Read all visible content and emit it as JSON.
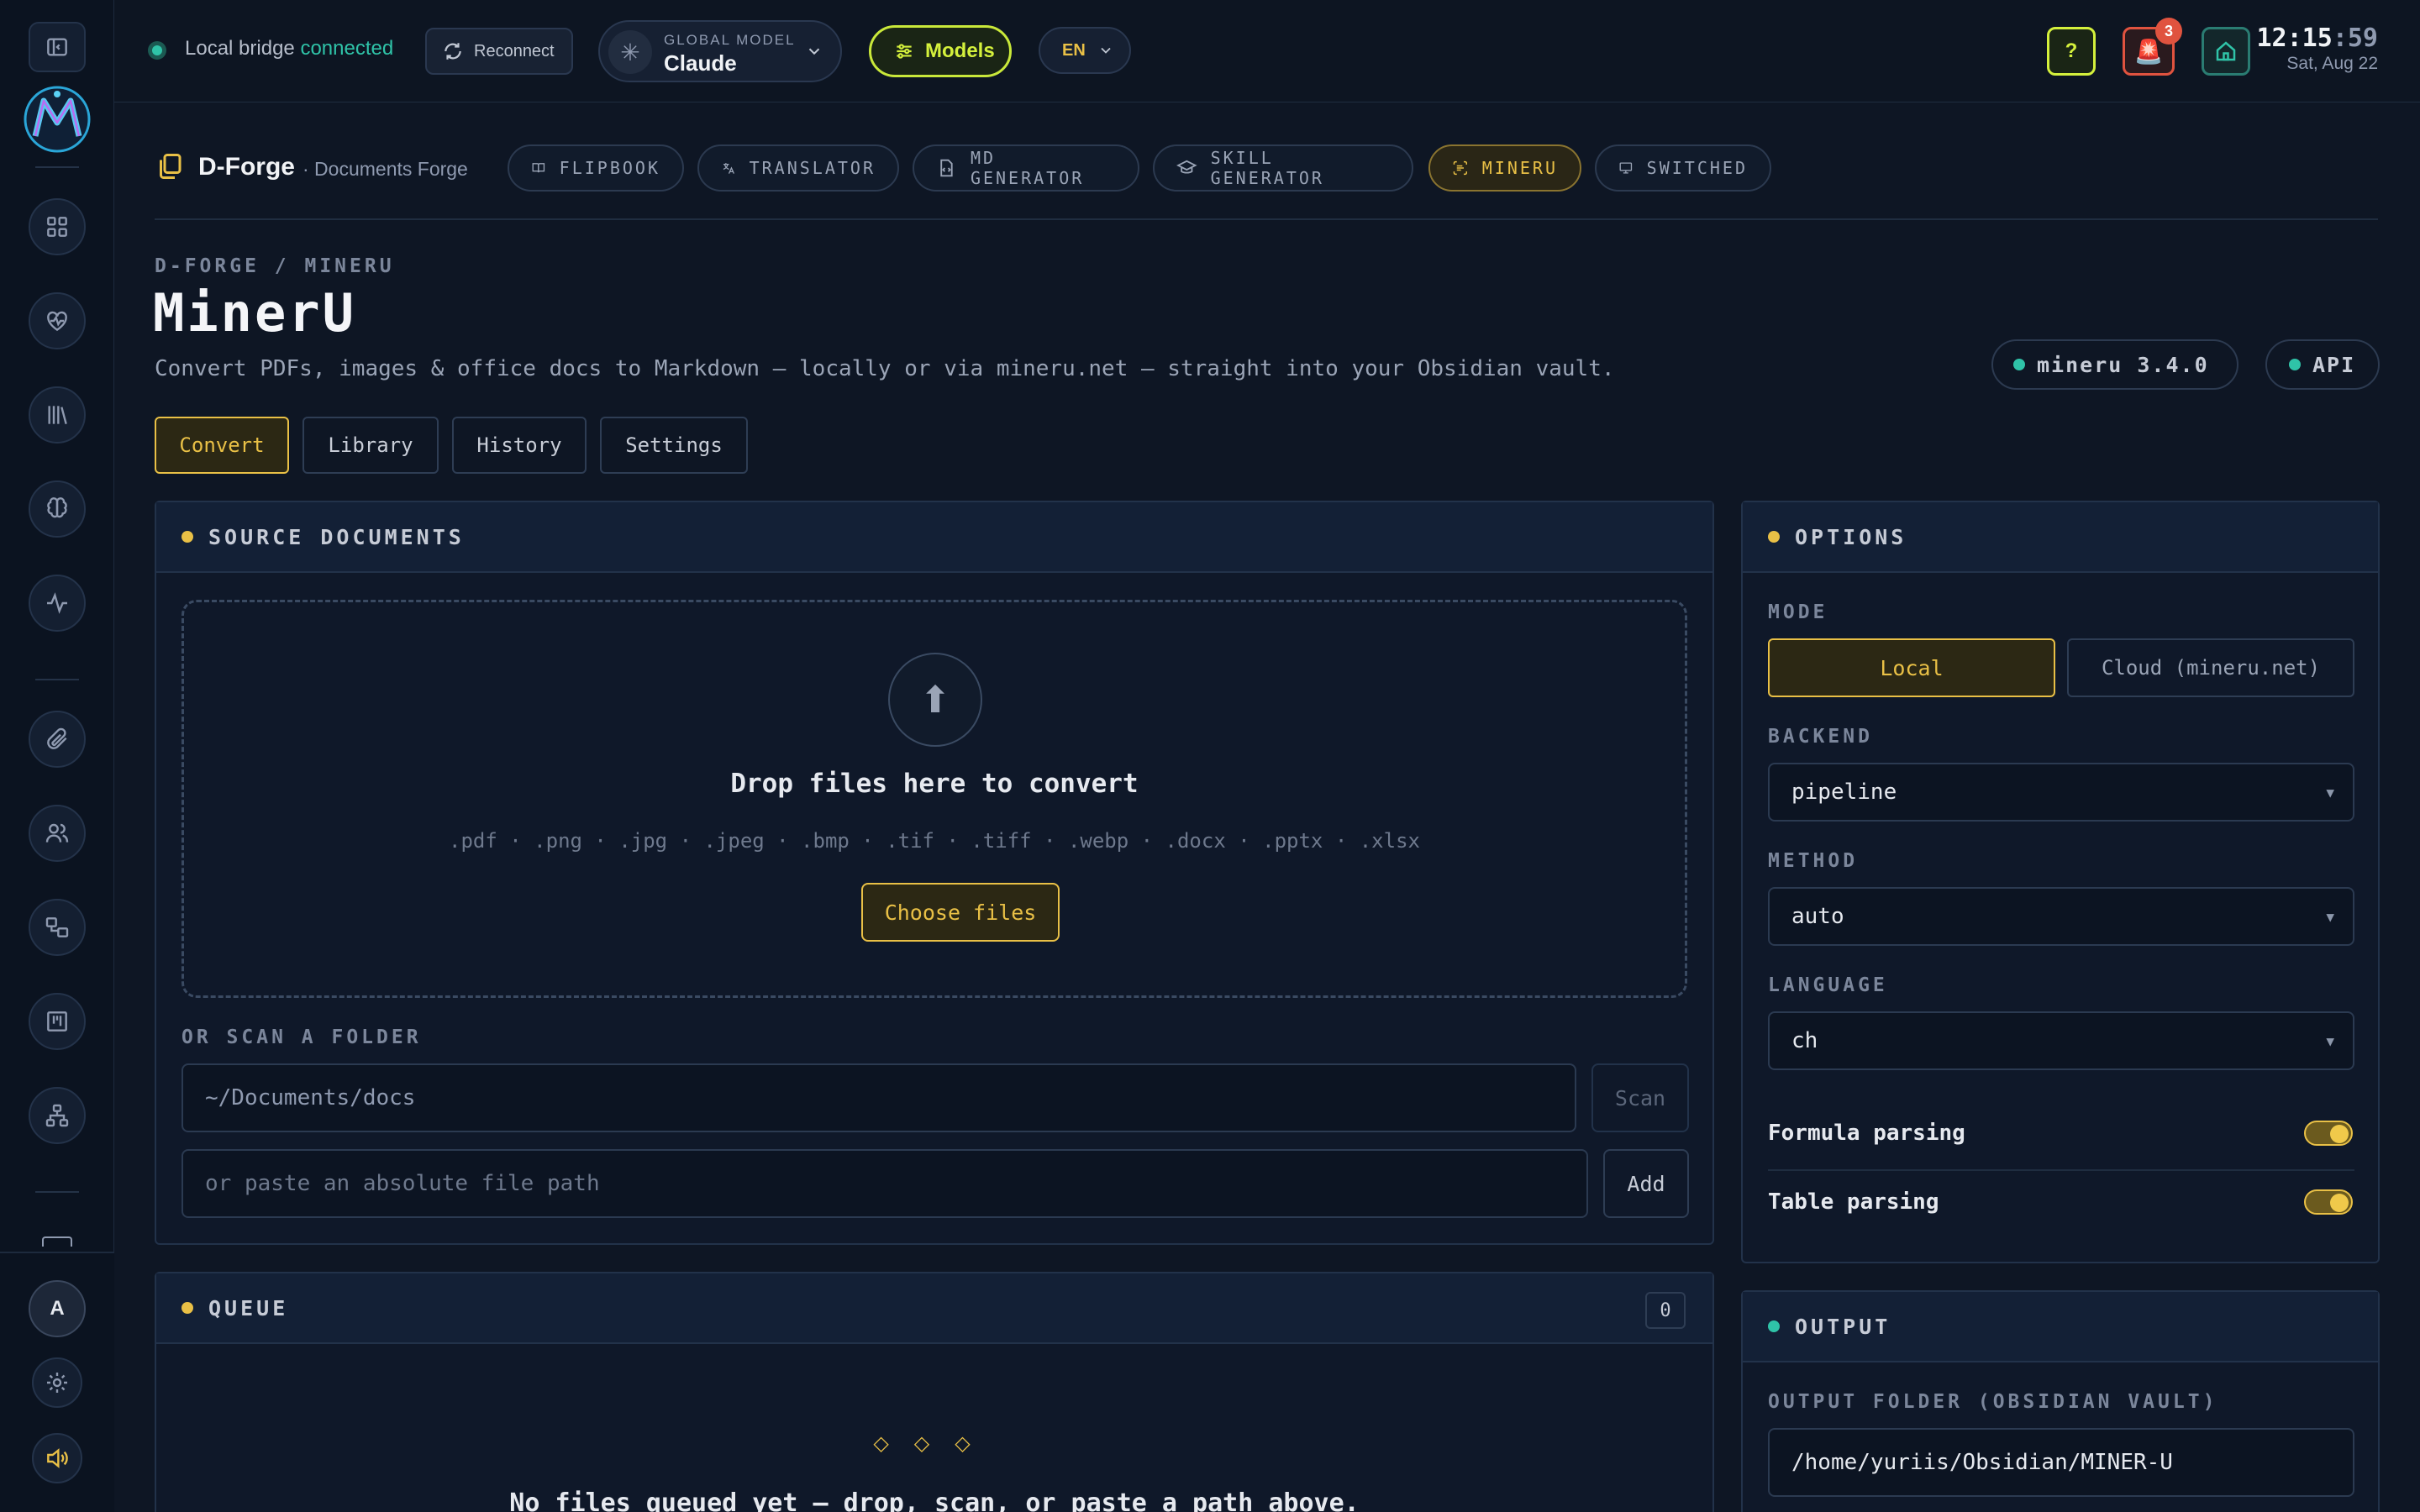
{
  "header": {
    "bridge_label": "Local bridge",
    "bridge_status": "connected",
    "reconnect_label": "Reconnect",
    "global_model_label": "GLOBAL MODEL",
    "global_model_value": "Claude",
    "models_label": "Models",
    "language": "EN",
    "help_label": "?",
    "alerts_count": "3",
    "clock_hm": "12:15",
    "clock_s": ":59",
    "date": "Sat, Aug 22"
  },
  "brand": {
    "name": "D-Forge",
    "subtitle": "· Documents Forge"
  },
  "nav_tabs": [
    "FLIPBOOK",
    "TRANSLATOR",
    "MD GENERATOR",
    "SKILL GENERATOR",
    "MINERU",
    "SWITCHED"
  ],
  "page": {
    "breadcrumb": "D-FORGE / MINERU",
    "title": "MinerU",
    "description": "Convert PDFs, images & office docs to Markdown — locally or via mineru.net — straight into your Obsidian vault.",
    "version_badge": "mineru 3.4.0",
    "api_badge": "API",
    "tabs": [
      "Convert",
      "Library",
      "History",
      "Settings"
    ]
  },
  "source": {
    "title": "SOURCE DOCUMENTS",
    "drop_title": "Drop files here to convert",
    "extensions": ".pdf · .png · .jpg · .jpeg · .bmp · .tif · .tiff · .webp · .docx · .pptx · .xlsx",
    "choose_label": "Choose files",
    "scan_label": "OR SCAN A FOLDER",
    "folder_value": "~/Documents/docs",
    "scan_button": "Scan",
    "path_placeholder": "or paste an absolute file path",
    "add_button": "Add"
  },
  "queue": {
    "title": "QUEUE",
    "count": "0",
    "empty_text": "No files queued yet — drop, scan, or paste a path above."
  },
  "options": {
    "title": "OPTIONS",
    "mode_label": "MODE",
    "mode_local": "Local",
    "mode_cloud": "Cloud (mineru.net)",
    "backend_label": "BACKEND",
    "backend_value": "pipeline",
    "method_label": "METHOD",
    "method_value": "auto",
    "language_label": "LANGUAGE",
    "language_value": "ch",
    "formula_label": "Formula parsing",
    "formula_on": true,
    "table_label": "Table parsing",
    "table_on": true
  },
  "output": {
    "title": "OUTPUT",
    "folder_label": "OUTPUT FOLDER (OBSIDIAN VAULT)",
    "folder_value": "/home/yuriis/Obsidian/MINER-U"
  },
  "user": {
    "avatar_initial": "A"
  },
  "colors": {
    "accent": "#e9c046",
    "teal": "#2fc3a8",
    "lime": "#d4f03c",
    "alert": "#e0533f",
    "bg": "#0e1624"
  }
}
